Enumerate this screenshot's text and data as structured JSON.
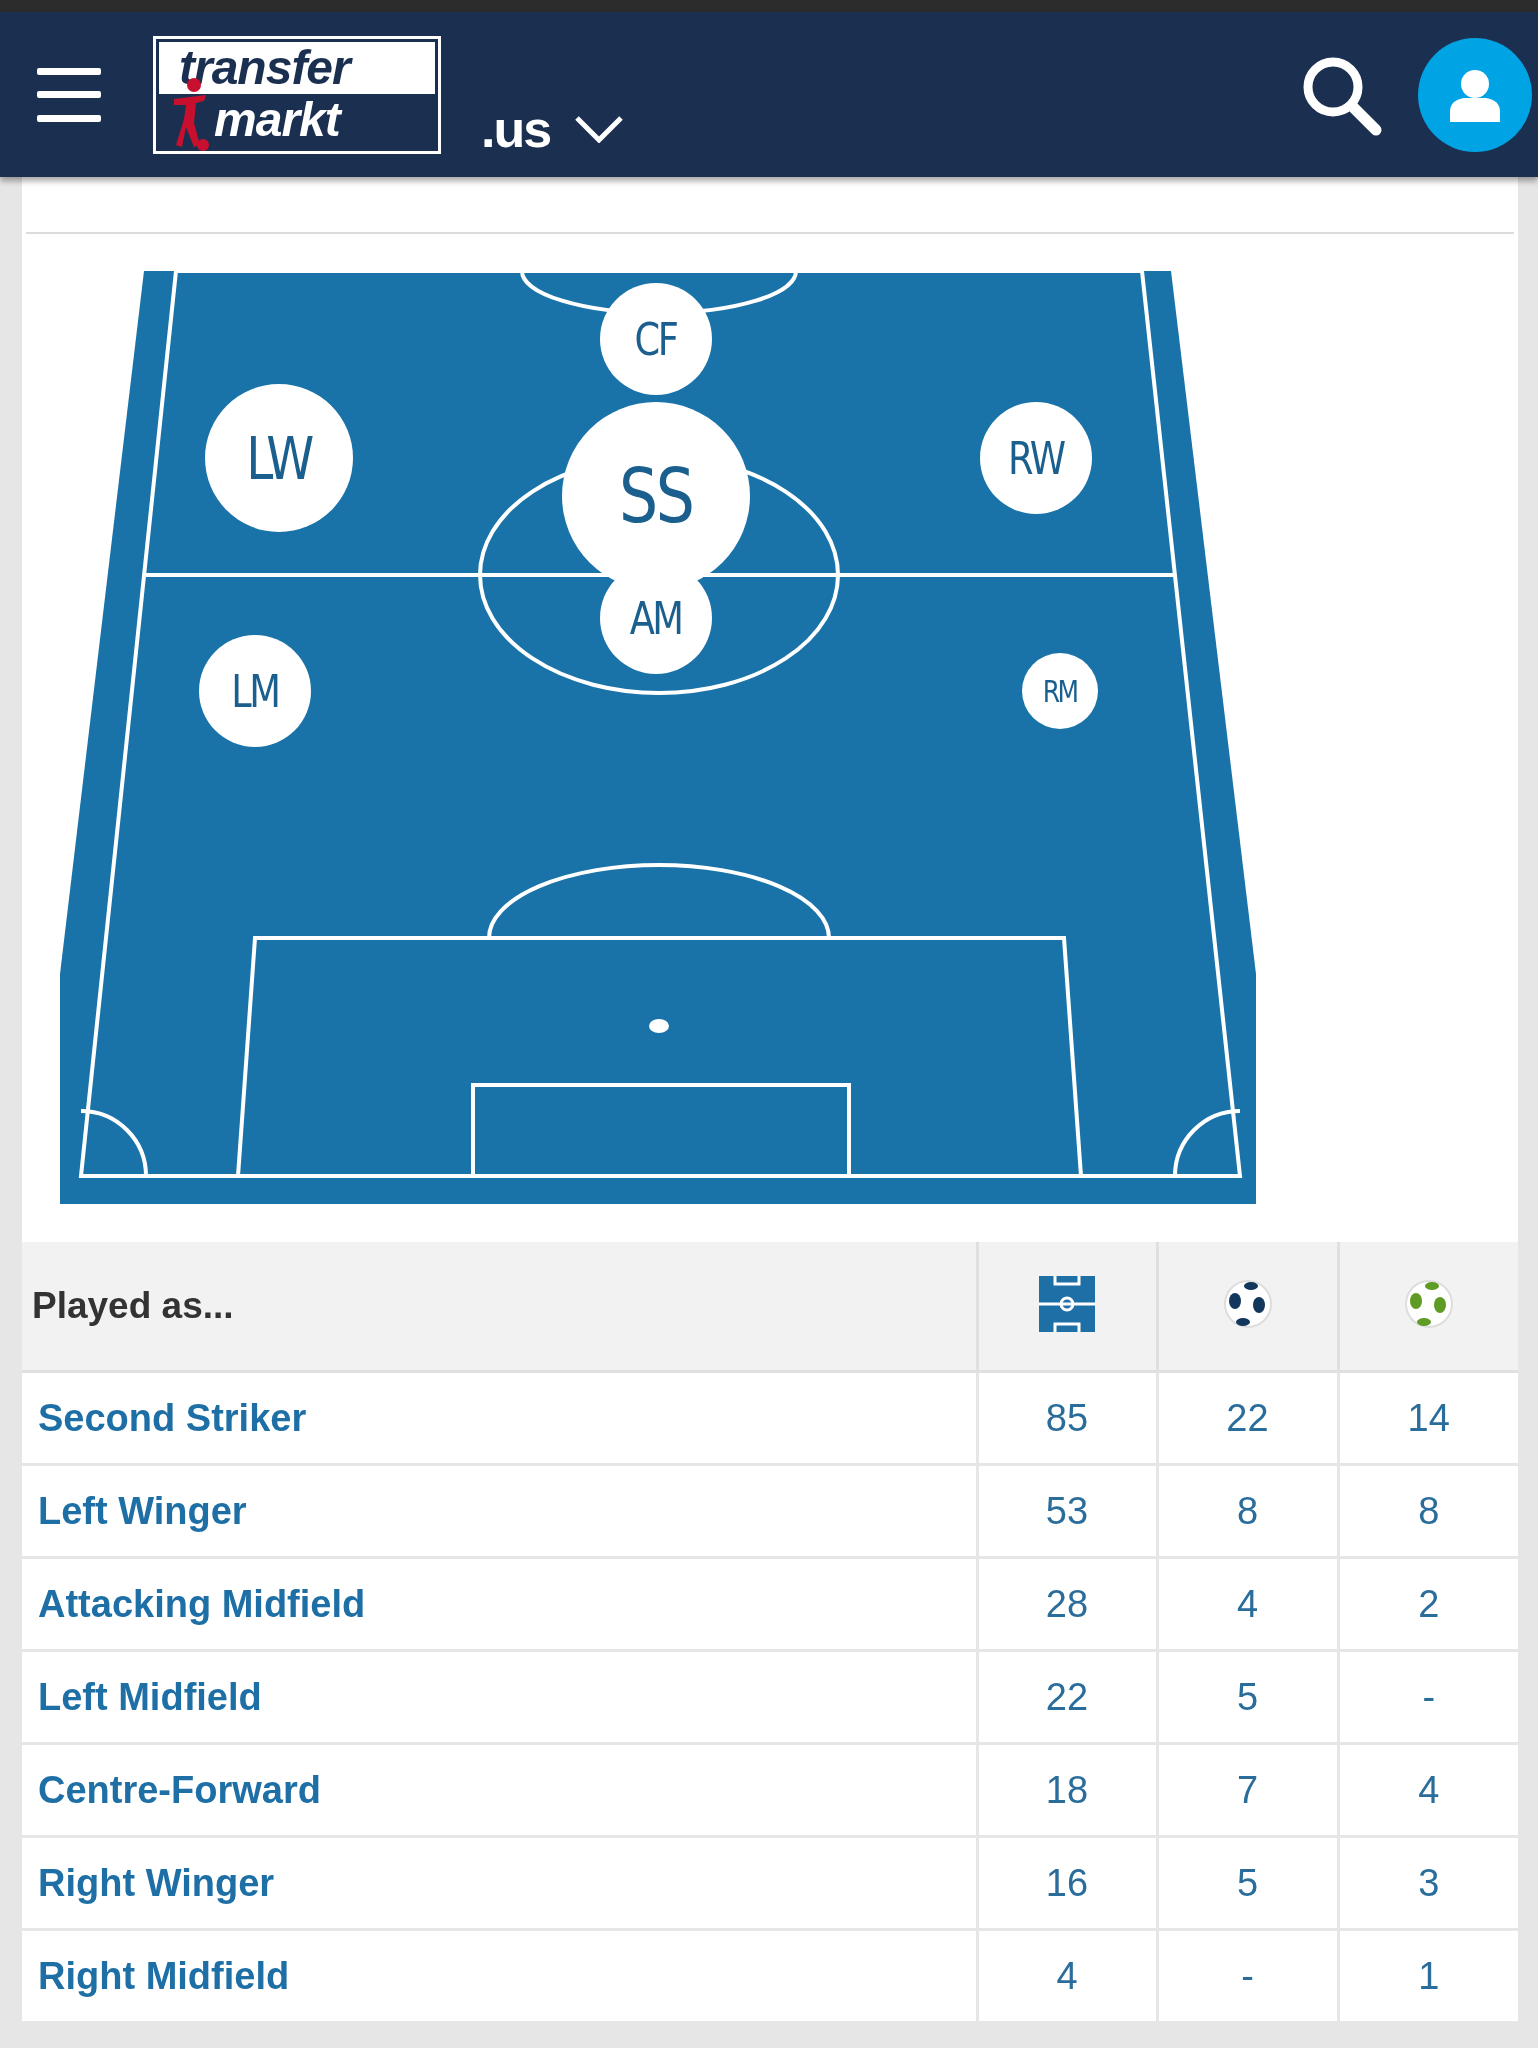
{
  "header": {
    "logo": {
      "line_1": "transfer",
      "line_2": "markt"
    },
    "domain": ".us"
  },
  "positions": [
    {
      "label": "CF",
      "kind": "medium"
    },
    {
      "label": "LW",
      "kind": "large"
    },
    {
      "label": "SS",
      "kind": "huge"
    },
    {
      "label": "RW",
      "kind": "medium"
    },
    {
      "label": "AM",
      "kind": "medium"
    },
    {
      "label": "LM",
      "kind": "medium"
    },
    {
      "label": "RM",
      "kind": "small"
    }
  ],
  "table": {
    "columns": [
      {
        "kind": "text",
        "label": "Played as..."
      },
      {
        "kind": "appearances"
      },
      {
        "kind": "goals"
      },
      {
        "kind": "assists"
      }
    ],
    "rows": [
      {
        "position": "Second Striker",
        "cells": [
          "85",
          "22",
          "14"
        ]
      },
      {
        "position": "Left Winger",
        "cells": [
          "53",
          "8",
          "8"
        ]
      },
      {
        "position": "Attacking Midfield",
        "cells": [
          "28",
          "4",
          "2"
        ]
      },
      {
        "position": "Left Midfield",
        "cells": [
          "22",
          "5",
          "-"
        ]
      },
      {
        "position": "Centre-Forward",
        "cells": [
          "18",
          "7",
          "4"
        ]
      },
      {
        "position": "Right Winger",
        "cells": [
          "16",
          "5",
          "3"
        ]
      },
      {
        "position": "Right Midfield",
        "cells": [
          "4",
          "-",
          "1"
        ]
      }
    ]
  }
}
